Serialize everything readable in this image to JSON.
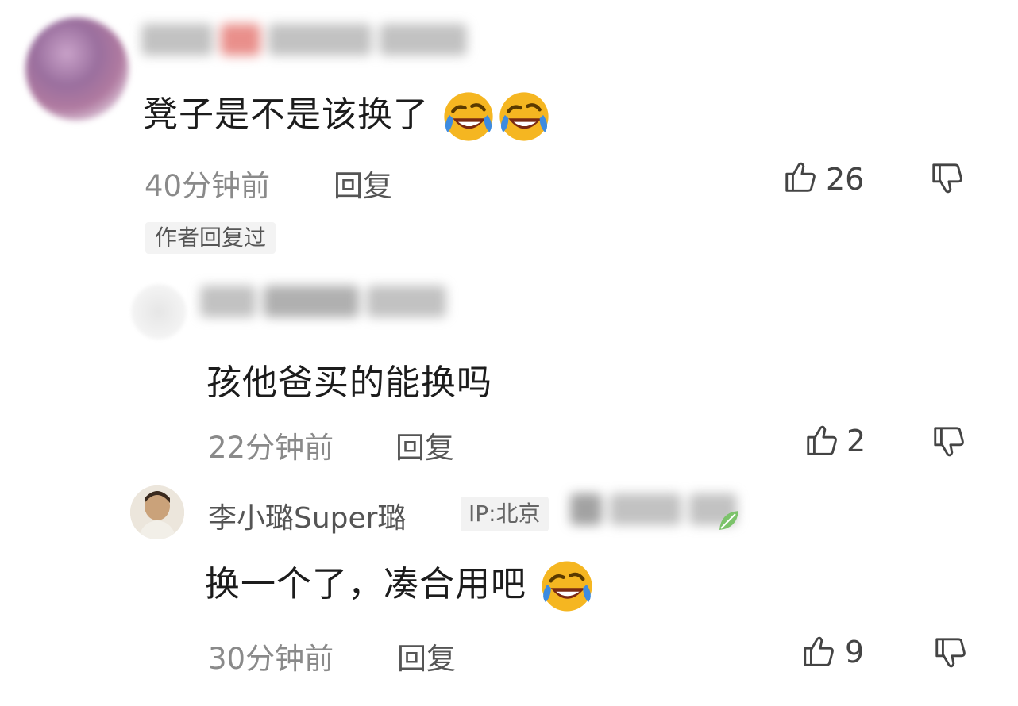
{
  "comments": [
    {
      "text": "凳子是不是该换了",
      "time": "40分钟前",
      "reply_label": "回复",
      "like_count": "26",
      "author_tag": "作者回复过"
    },
    {
      "text": "孩他爸买的能换吗",
      "time": "22分钟前",
      "reply_label": "回复",
      "like_count": "2"
    },
    {
      "username": "李小璐Super璐",
      "ip": "IP:北京",
      "text": "换一个了，凑合用吧",
      "time": "30分钟前",
      "reply_label": "回复",
      "like_count": "9"
    }
  ],
  "icons": {
    "like": "thumbs-up-icon",
    "dislike": "thumbs-down-icon",
    "emoji": "rolling-on-floor-laughing-crying-emoji",
    "badge": "leaf-icon"
  },
  "colors": {
    "emoji_face": "#f5b621",
    "tear": "#3d8be0",
    "leaf": "#7cc36b"
  }
}
